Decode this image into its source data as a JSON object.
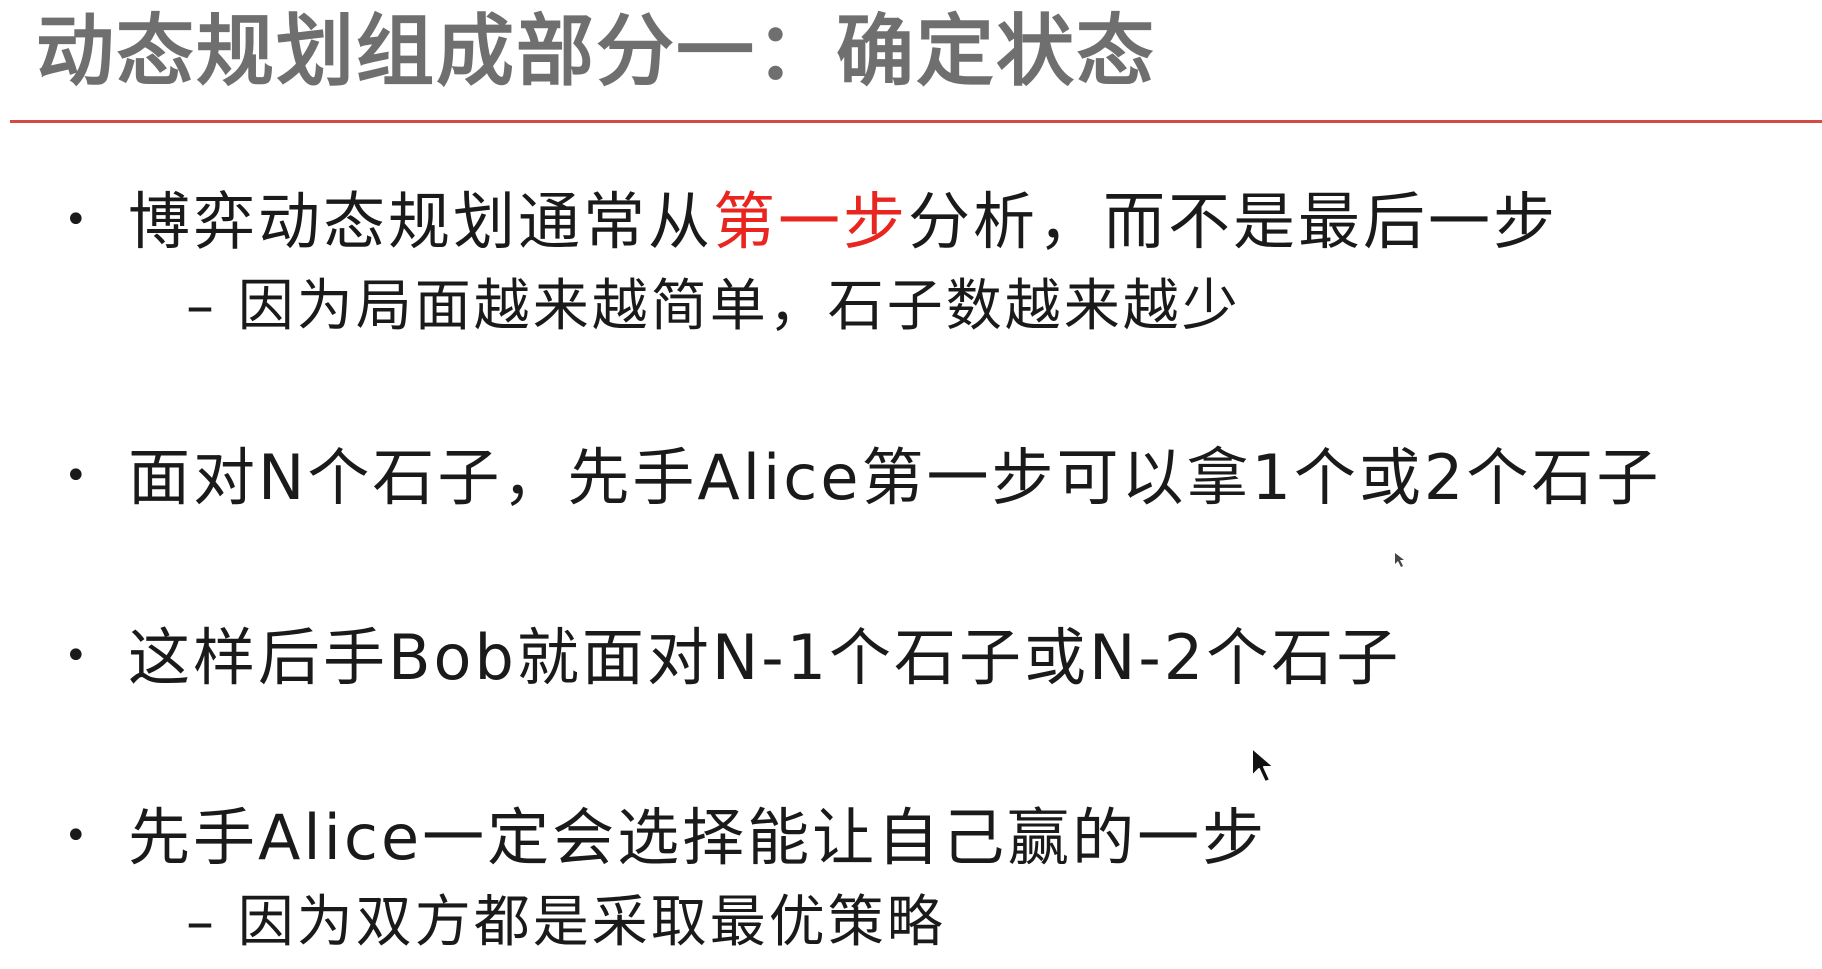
{
  "slide": {
    "title": "动态规划组成部分一：确定状态",
    "bullets": [
      {
        "marker": "•",
        "text_before": "博弈动态规划通常从",
        "highlight": "第一步",
        "text_after": "分析，而不是最后一步",
        "sub": "– 因为局面越来越简单，石子数越来越少"
      },
      {
        "marker": "•",
        "text": "面对N个石子，先手Alice第一步可以拿1个或2个石子"
      },
      {
        "marker": "•",
        "text": "这样后手Bob就面对N-1个石子或N-2个石子"
      },
      {
        "marker": "•",
        "text": "先手Alice一定会选择能让自己赢的一步",
        "sub": "– 因为双方都是采取最优策略"
      }
    ]
  },
  "colors": {
    "title": "#6f6f6f",
    "rule": "#d44a45",
    "highlight": "#e8261f",
    "body": "#1a1a1a"
  },
  "icons": {
    "cursor": "mouse-pointer-icon"
  }
}
